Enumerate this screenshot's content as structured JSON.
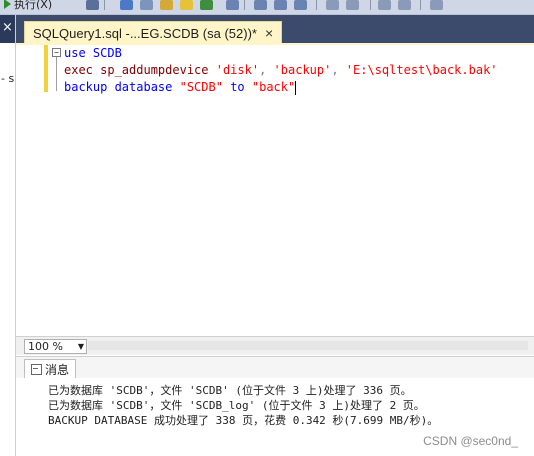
{
  "toolbar": {
    "run_label": "执行(X)"
  },
  "left_panel": {
    "pin_glyph": "×",
    "text": "- s"
  },
  "tab": {
    "title": "SQLQuery1.sql -...EG.SCDB (sa (52))*",
    "close_glyph": "×",
    "fold_glyph": "−"
  },
  "editor": {
    "line1": {
      "kw": "use",
      "rest": " SCDB"
    },
    "line2": {
      "fn": "exec sp_addumpdevice",
      "s1": "'disk'",
      "c1": ", ",
      "s2": "'backup'",
      "c2": ", ",
      "s3": "'E:\\sqltest\\back.bak'"
    },
    "line3": {
      "kw": "backup database",
      "s1": "\"SCDB\"",
      "to": " to ",
      "s2": "\"back\""
    }
  },
  "zoom": {
    "value": "100 %",
    "arrow": "▼"
  },
  "messages": {
    "tab_label": "消息",
    "lines": [
      "已为数据库 'SCDB'，文件 'SCDB' (位于文件 3 上)处理了 336 页。",
      "已为数据库 'SCDB'，文件 'SCDB_log' (位于文件 3 上)处理了 2 页。",
      "BACKUP DATABASE 成功处理了 338 页，花费 0.342 秒(7.699 MB/秒)。"
    ]
  },
  "watermark": "CSDN @sec0nd_",
  "colors": {
    "tab_active": "#fff5c8",
    "tab_strip": "#3c4a6b",
    "keyword": "#0000ff",
    "function": "#800000",
    "string": "#ff0000"
  }
}
